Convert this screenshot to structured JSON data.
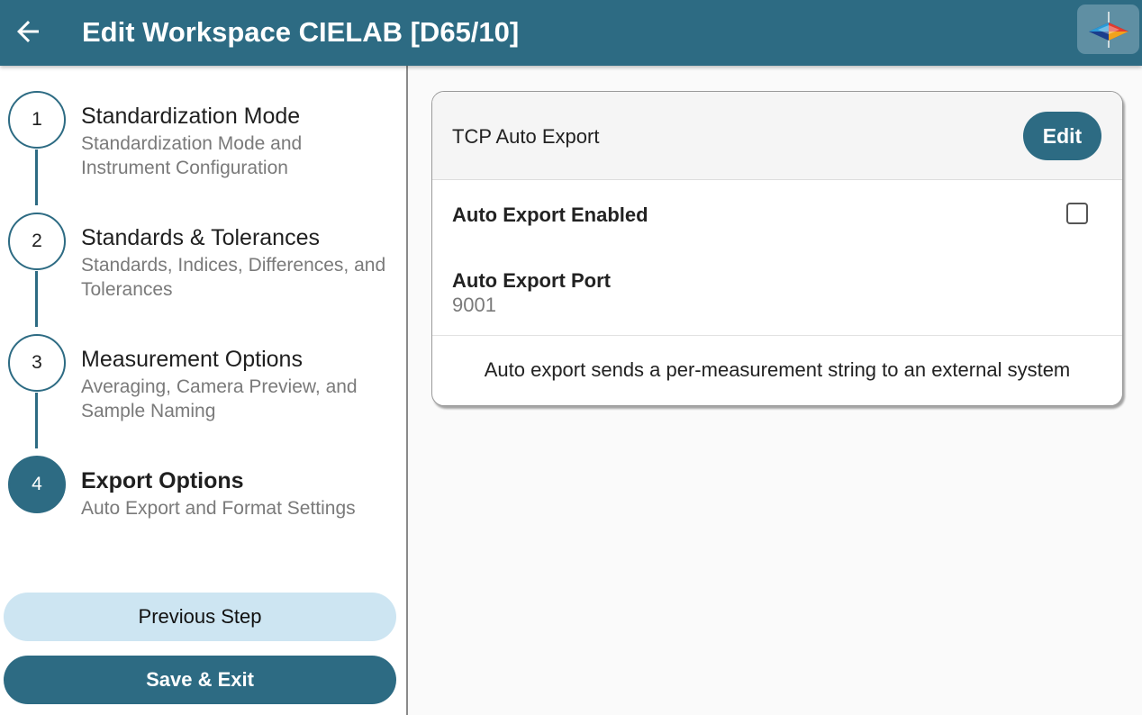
{
  "header": {
    "title": "Edit Workspace CIELAB [D65/10]",
    "back_icon": "arrow-left-icon",
    "logo_icon": "color-instrument-logo-icon"
  },
  "steps": [
    {
      "number": "1",
      "title": "Standardization Mode",
      "subtitle": "Standardization Mode and Instrument Configuration",
      "active": false
    },
    {
      "number": "2",
      "title": "Standards & Tolerances",
      "subtitle": "Standards, Indices, Differences, and Tolerances",
      "active": false
    },
    {
      "number": "3",
      "title": "Measurement Options",
      "subtitle": "Averaging, Camera Preview, and Sample Naming",
      "active": false
    },
    {
      "number": "4",
      "title": "Export Options",
      "subtitle": "Auto Export and Format Settings",
      "active": true
    }
  ],
  "buttons": {
    "previous": "Previous Step",
    "save": "Save & Exit"
  },
  "card": {
    "title": "TCP Auto Export",
    "edit_label": "Edit",
    "auto_export_enabled_label": "Auto Export Enabled",
    "auto_export_enabled_checked": false,
    "auto_export_port_label": "Auto Export Port",
    "auto_export_port_value": "9001",
    "note": "Auto export sends a per-measurement string to an external system"
  },
  "colors": {
    "primary": "#2d6b83",
    "secondary_button": "#cde5f2",
    "muted_text": "#7a7a7a"
  }
}
